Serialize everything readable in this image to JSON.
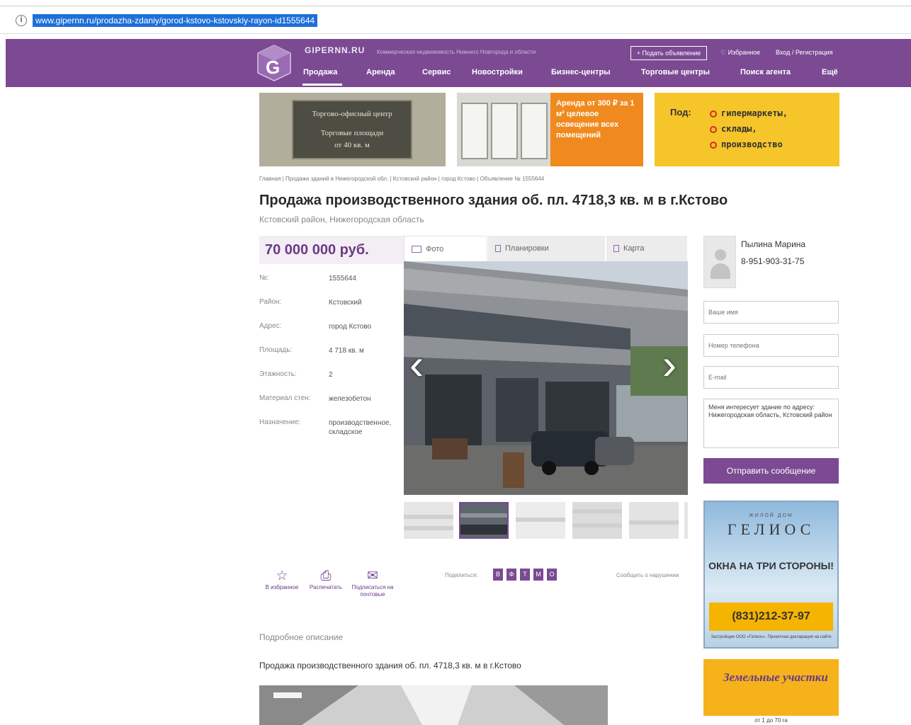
{
  "browser": {
    "url": "www.gipernn.ru/prodazha-zdaniy/gorod-kstovo-kstovskiy-rayon-id1555644"
  },
  "header": {
    "site_name": "GIPERNN.RU",
    "tagline": "Коммерческая недвижимость Нижнего Новгорода и области",
    "add_button": "+ Подать объявление",
    "favorites": "♡ Избранное",
    "login": "Вход / Регистрация",
    "nav": [
      "Продажа",
      "Аренда",
      "Сервис",
      "Новостройки",
      "Бизнес-центры",
      "Торговые центры",
      "Поиск агента",
      "Ещё"
    ]
  },
  "banners": {
    "b1_line1": "Торгово-офисный центр",
    "b1_line2": "Торговые площади",
    "b1_line3": "от 40 кв. м",
    "b2_text": "Аренда от 300 ₽ за 1 м² целевое освещение всех помещений",
    "b3_pod": "Под:",
    "b3_items": [
      "гипермаркеты,",
      "склады,",
      "производство"
    ]
  },
  "breadcrumbs": "Главная | Продажа зданий в Нижегородской обл. | Кстовский район | город Кстово | Объявление № 1555644",
  "title": "Продажа производственного здания об. пл. 4718,3 кв. м в г.Кстово",
  "subtitle": "Кстовский район, Нижегородская область",
  "price": "70 000 000 руб.",
  "details": [
    {
      "label": "№:",
      "value": "1555644"
    },
    {
      "label": "Район:",
      "value": "Кстовский"
    },
    {
      "label": "Адрес:",
      "value": "город Кстово"
    },
    {
      "label": "Площадь:",
      "value": "4 718 кв. м"
    },
    {
      "label": "Этажность:",
      "value": "2"
    },
    {
      "label": "Материал стен:",
      "value": "железобетон"
    },
    {
      "label": "Назначение:",
      "value": "производственное, складское"
    }
  ],
  "tabs": {
    "photo": "Фото",
    "plan": "Планировки",
    "map": "Карта"
  },
  "actions": {
    "favorite": "В избранное",
    "print": "Распечатать",
    "subscribe": "Подписаться на почтовые"
  },
  "share_label": "Поделиться:",
  "share_icons": [
    "В",
    "Ф",
    "Т",
    "М",
    "О"
  ],
  "report": "Сообщить о нарушении",
  "description_heading": "Подробное описание",
  "description_text": "Продажа производственного здания об. пл. 4718,3 кв. м  в г.Кстово",
  "agent": {
    "name": "Пылина Марина",
    "phone": "8-951-903-31-75"
  },
  "form": {
    "name_placeholder": "Ваше имя",
    "phone_placeholder": "Номер телефона",
    "email_placeholder": "E-mail",
    "message": "Меня интересует здание по адресу: Нижегородская область, Кстовский район",
    "send": "Отправить сообщение"
  },
  "ads": {
    "gelios_small": "ЖИЛОЙ ДОМ",
    "gelios_name": "ГЕЛИОС",
    "gelios_line": "ОКНА НА ТРИ СТОРОНЫ!",
    "gelios_phone": "(831)212-37-97",
    "gelios_note": "Застройщик ООО «Гелиос». Проектная декларация на сайте",
    "land_title": "Земельные участки",
    "land_strip": "от 1 до 70 га"
  }
}
